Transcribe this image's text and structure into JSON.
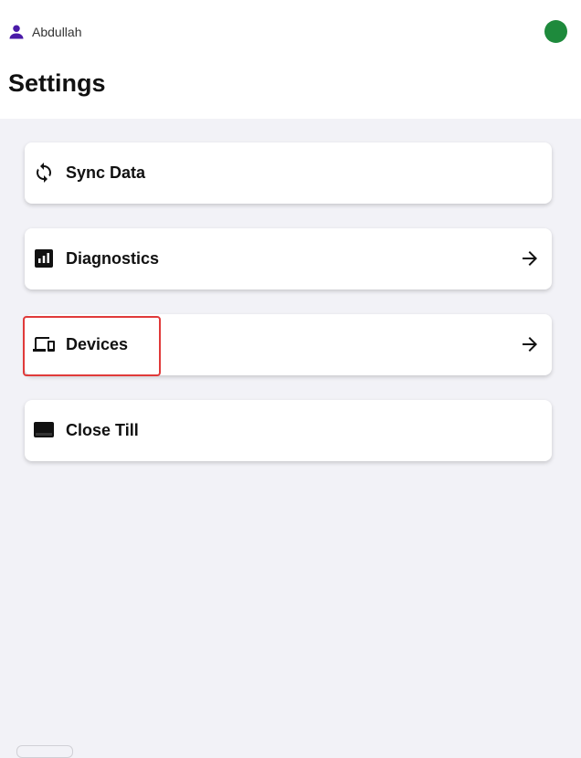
{
  "header": {
    "user_name": "Abdullah",
    "user_icon": "person-icon",
    "status_color": "#1e8a3c",
    "title": "Settings"
  },
  "colors": {
    "accent_purple": "#4a1aa8",
    "highlight_red": "#e03a3a",
    "background": "#f2f2f7"
  },
  "menu": [
    {
      "label": "Sync Data",
      "icon": "sync-icon",
      "has_arrow": false
    },
    {
      "label": "Diagnostics",
      "icon": "diagnostics-chart-icon",
      "has_arrow": true
    },
    {
      "label": "Devices",
      "icon": "devices-icon",
      "has_arrow": true
    },
    {
      "label": "Close Till",
      "icon": "till-icon",
      "has_arrow": false
    }
  ]
}
